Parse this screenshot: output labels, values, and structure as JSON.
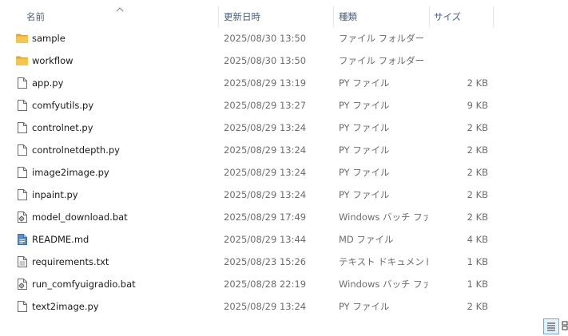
{
  "header": {
    "columns": [
      {
        "key": "name",
        "label": "名前"
      },
      {
        "key": "date",
        "label": "更新日時"
      },
      {
        "key": "type",
        "label": "種類"
      },
      {
        "key": "size",
        "label": "サイズ"
      }
    ]
  },
  "files": [
    {
      "name": "sample",
      "date": "2025/08/30 13:50",
      "type": "ファイル フォルダー",
      "size": "",
      "icon": "folder-icon"
    },
    {
      "name": "workflow",
      "date": "2025/08/30 13:50",
      "type": "ファイル フォルダー",
      "size": "",
      "icon": "folder-icon"
    },
    {
      "name": "app.py",
      "date": "2025/08/29 13:19",
      "type": "PY ファイル",
      "size": "2 KB",
      "icon": "file-icon"
    },
    {
      "name": "comfyutils.py",
      "date": "2025/08/29 13:27",
      "type": "PY ファイル",
      "size": "9 KB",
      "icon": "file-icon"
    },
    {
      "name": "controlnet.py",
      "date": "2025/08/29 13:24",
      "type": "PY ファイル",
      "size": "2 KB",
      "icon": "file-icon"
    },
    {
      "name": "controlnetdepth.py",
      "date": "2025/08/29 13:24",
      "type": "PY ファイル",
      "size": "2 KB",
      "icon": "file-icon"
    },
    {
      "name": "image2image.py",
      "date": "2025/08/29 13:24",
      "type": "PY ファイル",
      "size": "2 KB",
      "icon": "file-icon"
    },
    {
      "name": "inpaint.py",
      "date": "2025/08/29 13:24",
      "type": "PY ファイル",
      "size": "2 KB",
      "icon": "file-icon"
    },
    {
      "name": "model_download.bat",
      "date": "2025/08/29 17:49",
      "type": "Windows バッチ ファ...",
      "size": "2 KB",
      "icon": "batch-file-icon"
    },
    {
      "name": "README.md",
      "date": "2025/08/29 13:44",
      "type": "MD ファイル",
      "size": "4 KB",
      "icon": "markdown-file-icon"
    },
    {
      "name": "requirements.txt",
      "date": "2025/08/23 15:26",
      "type": "テキスト ドキュメント",
      "size": "1 KB",
      "icon": "text-file-icon"
    },
    {
      "name": "run_comfyuigradio.bat",
      "date": "2025/08/28 22:19",
      "type": "Windows バッチ ファ...",
      "size": "1 KB",
      "icon": "batch-file-icon"
    },
    {
      "name": "text2image.py",
      "date": "2025/08/29 13:24",
      "type": "PY ファイル",
      "size": "2 KB",
      "icon": "file-icon"
    }
  ],
  "colors": {
    "folder": "#F4C553",
    "folder_dark": "#E0A82E",
    "header_text": "#4C607A",
    "meta_text": "#6D6D6D",
    "selected_view": "#E5F1FB"
  }
}
